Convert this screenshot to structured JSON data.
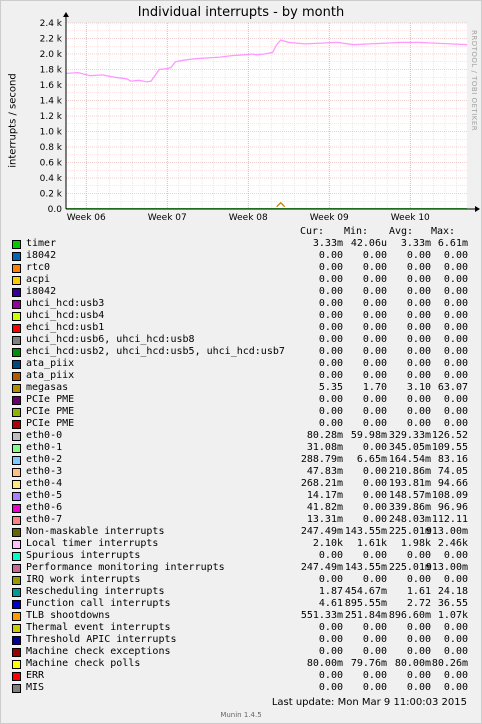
{
  "chart_data": {
    "type": "line",
    "title": "Individual interrupts - by month",
    "ylabel": "interrupts / second",
    "xlabel": "",
    "watermark": "RRDTOOL / TOBI OETIKER",
    "ylim": [
      0,
      2400
    ],
    "y_ticks": [
      {
        "value": 0,
        "label": "0.0"
      },
      {
        "value": 200,
        "label": "0.2 k"
      },
      {
        "value": 400,
        "label": "0.4 k"
      },
      {
        "value": 600,
        "label": "0.6 k"
      },
      {
        "value": 800,
        "label": "0.8 k"
      },
      {
        "value": 1000,
        "label": "1.0 k"
      },
      {
        "value": 1200,
        "label": "1.2 k"
      },
      {
        "value": 1400,
        "label": "1.4 k"
      },
      {
        "value": 1600,
        "label": "1.6 k"
      },
      {
        "value": 1800,
        "label": "1.8 k"
      },
      {
        "value": 2000,
        "label": "2.0 k"
      },
      {
        "value": 2200,
        "label": "2.2 k"
      },
      {
        "value": 2400,
        "label": "2.4 k"
      }
    ],
    "x_ticks": [
      "Week 06",
      "Week 07",
      "Week 08",
      "Week 09",
      "Week 10"
    ],
    "xlim_weeks": [
      5.75,
      10.7
    ],
    "grid": true,
    "series": [
      {
        "name": "Local timer interrupts",
        "color": "#ff99ff",
        "x_weeks": [
          5.75,
          5.9,
          6.05,
          6.2,
          6.35,
          6.5,
          6.55,
          6.65,
          6.75,
          6.8,
          6.9,
          7.0,
          7.05,
          7.1,
          7.2,
          7.35,
          7.5,
          7.65,
          7.8,
          7.95,
          8.05,
          8.1,
          8.2,
          8.3,
          8.35,
          8.4,
          8.5,
          8.7,
          8.9,
          9.1,
          9.3,
          9.5,
          9.7,
          9.9,
          10.1,
          10.3,
          10.5,
          10.7
        ],
        "values": [
          1750,
          1760,
          1720,
          1730,
          1700,
          1680,
          1650,
          1660,
          1640,
          1650,
          1800,
          1810,
          1830,
          1900,
          1920,
          1940,
          1950,
          1960,
          1980,
          1990,
          2000,
          1990,
          2000,
          2020,
          2120,
          2180,
          2150,
          2130,
          2140,
          2150,
          2120,
          2130,
          2140,
          2150,
          2150,
          2140,
          2130,
          2120
        ]
      },
      {
        "name": "megasas",
        "color": "#cc7a00",
        "x_weeks": [
          8.35,
          8.4,
          8.45
        ],
        "values": [
          30,
          80,
          30
        ]
      },
      {
        "name": "timer",
        "color": "#00cc00",
        "x_weeks": [
          5.75,
          10.7
        ],
        "values": [
          3,
          3
        ]
      }
    ]
  },
  "legend": {
    "headers": {
      "cur": "Cur:",
      "min": "Min:",
      "avg": "Avg:",
      "max": "Max:"
    },
    "rows": [
      {
        "label": "timer",
        "color": "#00cc00",
        "cur": "3.33m",
        "min": "42.06u",
        "avg": "3.33m",
        "max": "6.61m"
      },
      {
        "label": "i8042",
        "color": "#0066b3",
        "cur": "0.00",
        "min": "0.00",
        "avg": "0.00",
        "max": "0.00"
      },
      {
        "label": "rtc0",
        "color": "#ff8000",
        "cur": "0.00",
        "min": "0.00",
        "avg": "0.00",
        "max": "0.00"
      },
      {
        "label": "acpi",
        "color": "#ffcc00",
        "cur": "0.00",
        "min": "0.00",
        "avg": "0.00",
        "max": "0.00"
      },
      {
        "label": "i8042",
        "color": "#330099",
        "cur": "0.00",
        "min": "0.00",
        "avg": "0.00",
        "max": "0.00"
      },
      {
        "label": "uhci_hcd:usb3",
        "color": "#990099",
        "cur": "0.00",
        "min": "0.00",
        "avg": "0.00",
        "max": "0.00"
      },
      {
        "label": "uhci_hcd:usb4",
        "color": "#ccff00",
        "cur": "0.00",
        "min": "0.00",
        "avg": "0.00",
        "max": "0.00"
      },
      {
        "label": "ehci_hcd:usb1",
        "color": "#ff0000",
        "cur": "0.00",
        "min": "0.00",
        "avg": "0.00",
        "max": "0.00"
      },
      {
        "label": "uhci_hcd:usb6, uhci_hcd:usb8",
        "color": "#808080",
        "cur": "0.00",
        "min": "0.00",
        "avg": "0.00",
        "max": "0.00"
      },
      {
        "label": "ehci_hcd:usb2, uhci_hcd:usb5, uhci_hcd:usb7",
        "color": "#008f00",
        "cur": "0.00",
        "min": "0.00",
        "avg": "0.00",
        "max": "0.00"
      },
      {
        "label": "ata_piix",
        "color": "#00487d",
        "cur": "0.00",
        "min": "0.00",
        "avg": "0.00",
        "max": "0.00"
      },
      {
        "label": "ata_piix",
        "color": "#b35a00",
        "cur": "0.00",
        "min": "0.00",
        "avg": "0.00",
        "max": "0.00"
      },
      {
        "label": "megasas",
        "color": "#b38f00",
        "cur": "5.35",
        "min": "1.70",
        "avg": "3.10",
        "max": "63.07"
      },
      {
        "label": "PCIe PME",
        "color": "#6b006b",
        "cur": "0.00",
        "min": "0.00",
        "avg": "0.00",
        "max": "0.00"
      },
      {
        "label": "PCIe PME",
        "color": "#8fb300",
        "cur": "0.00",
        "min": "0.00",
        "avg": "0.00",
        "max": "0.00"
      },
      {
        "label": "PCIe PME",
        "color": "#b30000",
        "cur": "0.00",
        "min": "0.00",
        "avg": "0.00",
        "max": "0.00"
      },
      {
        "label": "eth0-0",
        "color": "#bebebe",
        "cur": "80.28m",
        "min": "59.98m",
        "avg": "329.33m",
        "max": "126.52"
      },
      {
        "label": "eth0-1",
        "color": "#80ff80",
        "cur": "31.08m",
        "min": "0.00",
        "avg": "345.05m",
        "max": "109.55"
      },
      {
        "label": "eth0-2",
        "color": "#80c9ff",
        "cur": "288.79m",
        "min": "6.65m",
        "avg": "164.54m",
        "max": "83.16"
      },
      {
        "label": "eth0-3",
        "color": "#ffc080",
        "cur": "47.83m",
        "min": "0.00",
        "avg": "210.86m",
        "max": "74.05"
      },
      {
        "label": "eth0-4",
        "color": "#ffe680",
        "cur": "268.21m",
        "min": "0.00",
        "avg": "193.81m",
        "max": "94.66"
      },
      {
        "label": "eth0-5",
        "color": "#aa80ff",
        "cur": "14.17m",
        "min": "0.00",
        "avg": "148.57m",
        "max": "108.09"
      },
      {
        "label": "eth0-6",
        "color": "#ee00cc",
        "cur": "41.82m",
        "min": "0.00",
        "avg": "339.86m",
        "max": "96.96"
      },
      {
        "label": "eth0-7",
        "color": "#ff8080",
        "cur": "13.31m",
        "min": "0.00",
        "avg": "248.03m",
        "max": "112.11"
      },
      {
        "label": "Non-maskable interrupts",
        "color": "#666600",
        "cur": "247.49m",
        "min": "143.55m",
        "avg": "225.01m",
        "max": "913.00m"
      },
      {
        "label": "Local timer interrupts",
        "color": "#ffbfff",
        "cur": "2.10k",
        "min": "1.61k",
        "avg": "1.98k",
        "max": "2.46k"
      },
      {
        "label": "Spurious interrupts",
        "color": "#00ffcc",
        "cur": "0.00",
        "min": "0.00",
        "avg": "0.00",
        "max": "0.00"
      },
      {
        "label": "Performance monitoring interrupts",
        "color": "#cc6699",
        "cur": "247.49m",
        "min": "143.55m",
        "avg": "225.01m",
        "max": "913.00m"
      },
      {
        "label": "IRQ work interrupts",
        "color": "#999900",
        "cur": "0.00",
        "min": "0.00",
        "avg": "0.00",
        "max": "0.00"
      },
      {
        "label": "Rescheduling interrupts",
        "color": "#009999",
        "cur": "1.87",
        "min": "454.67m",
        "avg": "1.61",
        "max": "24.18"
      },
      {
        "label": "Function call interrupts",
        "color": "#0000cc",
        "cur": "4.61",
        "min": "895.55m",
        "avg": "2.72",
        "max": "36.55"
      },
      {
        "label": "TLB shootdowns",
        "color": "#ff9900",
        "cur": "551.33m",
        "min": "251.84m",
        "avg": "896.60m",
        "max": "1.07k"
      },
      {
        "label": "Thermal event interrupts",
        "color": "#cccc00",
        "cur": "0.00",
        "min": "0.00",
        "avg": "0.00",
        "max": "0.00"
      },
      {
        "label": "Threshold APIC interrupts",
        "color": "#000099",
        "cur": "0.00",
        "min": "0.00",
        "avg": "0.00",
        "max": "0.00"
      },
      {
        "label": "Machine check exceptions",
        "color": "#990000",
        "cur": "0.00",
        "min": "0.00",
        "avg": "0.00",
        "max": "0.00"
      },
      {
        "label": "Machine check polls",
        "color": "#ffff00",
        "cur": "80.00m",
        "min": "79.76m",
        "avg": "80.00m",
        "max": "80.26m"
      },
      {
        "label": "ERR",
        "color": "#ff0000",
        "cur": "0.00",
        "min": "0.00",
        "avg": "0.00",
        "max": "0.00"
      },
      {
        "label": "MIS",
        "color": "#808080",
        "cur": "0.00",
        "min": "0.00",
        "avg": "0.00",
        "max": "0.00"
      }
    ]
  },
  "footer": {
    "last_update": "Last update:  Mon Mar  9 11:00:03 2015",
    "version": "Munin 1.4.5"
  }
}
